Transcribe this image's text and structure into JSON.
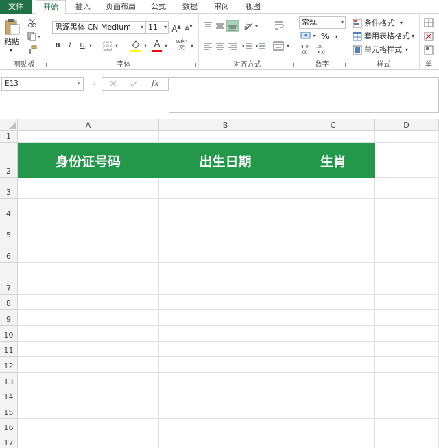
{
  "ribbon_tabs": [
    "文件",
    "开始",
    "插入",
    "页面布局",
    "公式",
    "数据",
    "审阅",
    "视图"
  ],
  "clipboard": {
    "paste_label": "粘贴",
    "group_label": "剪贴板"
  },
  "font": {
    "name": "思源黑体 CN Medium",
    "size": "11",
    "group_label": "字体",
    "bold": "B",
    "italic": "I",
    "underline": "U",
    "phonetic": "wén 文"
  },
  "alignment": {
    "group_label": "对齐方式"
  },
  "number": {
    "format": "常规",
    "percent": "%",
    "comma": ",",
    "group_label": "数字"
  },
  "styles": {
    "conditional": "条件格式",
    "table": "套用表格格式",
    "cell": "单元格样式",
    "group_label": "样式"
  },
  "cells_group_label": "单",
  "formula_bar": {
    "name_box": "E13",
    "fx": "fx",
    "value": ""
  },
  "columns": [
    "A",
    "B",
    "C",
    "D"
  ],
  "rows": [
    "1",
    "2",
    "3",
    "4",
    "5",
    "6",
    "7",
    "8",
    "9",
    "10",
    "11",
    "12",
    "13",
    "14",
    "15",
    "16",
    "17"
  ],
  "table_headers": {
    "A2": "身份证号码",
    "B2": "出生日期",
    "C2": "生肖"
  },
  "colors": {
    "accent": "#217346",
    "header_fill": "#23984b",
    "font_color_bar": "#ff0000",
    "fill_color_bar": "#ffff00"
  }
}
